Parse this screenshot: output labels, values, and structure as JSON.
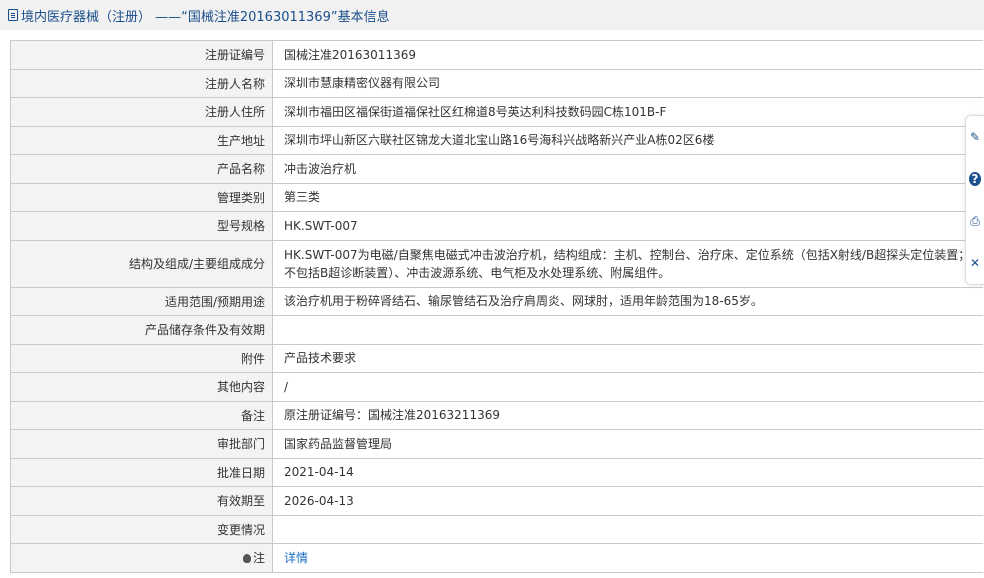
{
  "header": {
    "title": "境内医疗器械（注册） ——“国械注准20163011369”基本信息"
  },
  "rows": [
    {
      "label": "注册证编号",
      "value": "国械注准20163011369"
    },
    {
      "label": "注册人名称",
      "value": "深圳市慧康精密仪器有限公司"
    },
    {
      "label": "注册人住所",
      "value": "深圳市福田区福保街道福保社区红棉道8号英达利科技数码园C栋101B-F"
    },
    {
      "label": "生产地址",
      "value": "深圳市坪山新区六联社区锦龙大道北宝山路16号海科兴战略新兴产业A栋02区6楼"
    },
    {
      "label": "产品名称",
      "value": "冲击波治疗机"
    },
    {
      "label": "管理类别",
      "value": "第三类"
    },
    {
      "label": "型号规格",
      "value": "HK.SWT-007"
    },
    {
      "label": "结构及组成/主要组成成分",
      "value": "HK.SWT-007为电磁/自聚焦电磁式冲击波治疗机，结构组成：主机、控制台、治疗床、定位系统（包括X射线/B超探头定位装置；不包括B超诊断装置）、冲击波源系统、电气柜及水处理系统、附属组件。"
    },
    {
      "label": "适用范围/预期用途",
      "value": "该治疗机用于粉碎肾结石、输尿管结石及治疗肩周炎、网球肘，适用年龄范围为18-65岁。"
    },
    {
      "label": "产品储存条件及有效期",
      "value": ""
    },
    {
      "label": "附件",
      "value": "产品技术要求"
    },
    {
      "label": "其他内容",
      "value": "/"
    },
    {
      "label": "备注",
      "value": "原注册证编号：国械注准20163211369"
    },
    {
      "label": "审批部门",
      "value": "国家药品监督管理局"
    },
    {
      "label": "批准日期",
      "value": "2021-04-14"
    },
    {
      "label": "有效期至",
      "value": "2026-04-13"
    },
    {
      "label": "变更情况",
      "value": ""
    }
  ],
  "note_row": {
    "label": "注",
    "link": "详情"
  },
  "side_tools": {
    "icons": [
      "edit-icon",
      "help-icon",
      "print-icon",
      "close-icon"
    ],
    "glyphs": [
      "✎",
      "?",
      "⎙",
      "✕"
    ]
  }
}
